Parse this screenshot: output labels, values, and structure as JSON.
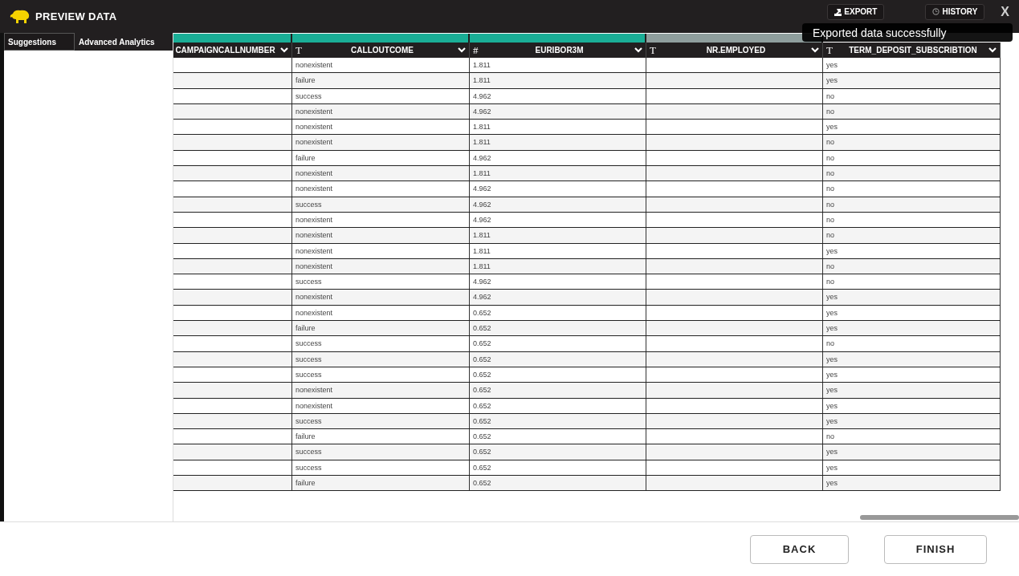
{
  "window": {
    "title": "PREVIEW DATA"
  },
  "toolbar": {
    "buttons": [
      {
        "label": "EXPORT",
        "kind": "export"
      },
      {
        "label": "HISTORY",
        "kind": "history"
      }
    ],
    "close": "X"
  },
  "toast": {
    "message": "Exported data successfully"
  },
  "tabs": [
    {
      "label": "Suggestions",
      "selected": true
    },
    {
      "label": "Advanced Analytics",
      "selected": false
    }
  ],
  "table": {
    "columns": [
      {
        "name": "CAMPAIGNCALLNUMBER",
        "color": "#1aae96"
      },
      {
        "name": "CALLOUTCOME",
        "type": "T",
        "color": "#1aae96"
      },
      {
        "name": "EURIBOR3M",
        "type": "#",
        "color": "#1aae96"
      },
      {
        "name": "NR.EMPLOYED",
        "type": "T",
        "color": "#8f9e9d"
      },
      {
        "name": "TERM_DEPOSIT_SUBSCRIBTION",
        "type": "T"
      }
    ],
    "rows": [
      [
        null,
        "nonexistent",
        "1.811",
        null,
        "yes"
      ],
      [
        null,
        "failure",
        "1.811",
        null,
        "yes"
      ],
      [
        null,
        "success",
        "4.962",
        null,
        "no"
      ],
      [
        null,
        "nonexistent",
        "4.962",
        null,
        "no"
      ],
      [
        null,
        "nonexistent",
        "1.811",
        null,
        "yes"
      ],
      [
        null,
        "nonexistent",
        "1.811",
        null,
        "no"
      ],
      [
        null,
        "failure",
        "4.962",
        null,
        "no"
      ],
      [
        null,
        "nonexistent",
        "1.811",
        null,
        "no"
      ],
      [
        null,
        "nonexistent",
        "4.962",
        null,
        "no"
      ],
      [
        null,
        "success",
        "4.962",
        null,
        "no"
      ],
      [
        null,
        "nonexistent",
        "4.962",
        null,
        "no"
      ],
      [
        null,
        "nonexistent",
        "1.811",
        null,
        "no"
      ],
      [
        null,
        "nonexistent",
        "1.811",
        null,
        "yes"
      ],
      [
        null,
        "nonexistent",
        "1.811",
        null,
        "no"
      ],
      [
        null,
        "success",
        "4.962",
        null,
        "no"
      ],
      [
        null,
        "nonexistent",
        "4.962",
        null,
        "yes"
      ],
      [
        null,
        "nonexistent",
        "0.652",
        null,
        "yes"
      ],
      [
        null,
        "failure",
        "0.652",
        null,
        "yes"
      ],
      [
        null,
        "success",
        "0.652",
        null,
        "no"
      ],
      [
        null,
        "success",
        "0.652",
        null,
        "yes"
      ],
      [
        null,
        "success",
        "0.652",
        null,
        "yes"
      ],
      [
        null,
        "nonexistent",
        "0.652",
        null,
        "yes"
      ],
      [
        null,
        "nonexistent",
        "0.652",
        null,
        "yes"
      ],
      [
        null,
        "success",
        "0.652",
        null,
        "yes"
      ],
      [
        null,
        "failure",
        "0.652",
        null,
        "no"
      ],
      [
        null,
        "success",
        "0.652",
        null,
        "yes"
      ],
      [
        null,
        "success",
        "0.652",
        null,
        "yes"
      ],
      [
        null,
        "failure",
        "0.652",
        null,
        "yes"
      ]
    ]
  },
  "footer": {
    "buttons": [
      "BACK",
      "FINISH"
    ]
  }
}
